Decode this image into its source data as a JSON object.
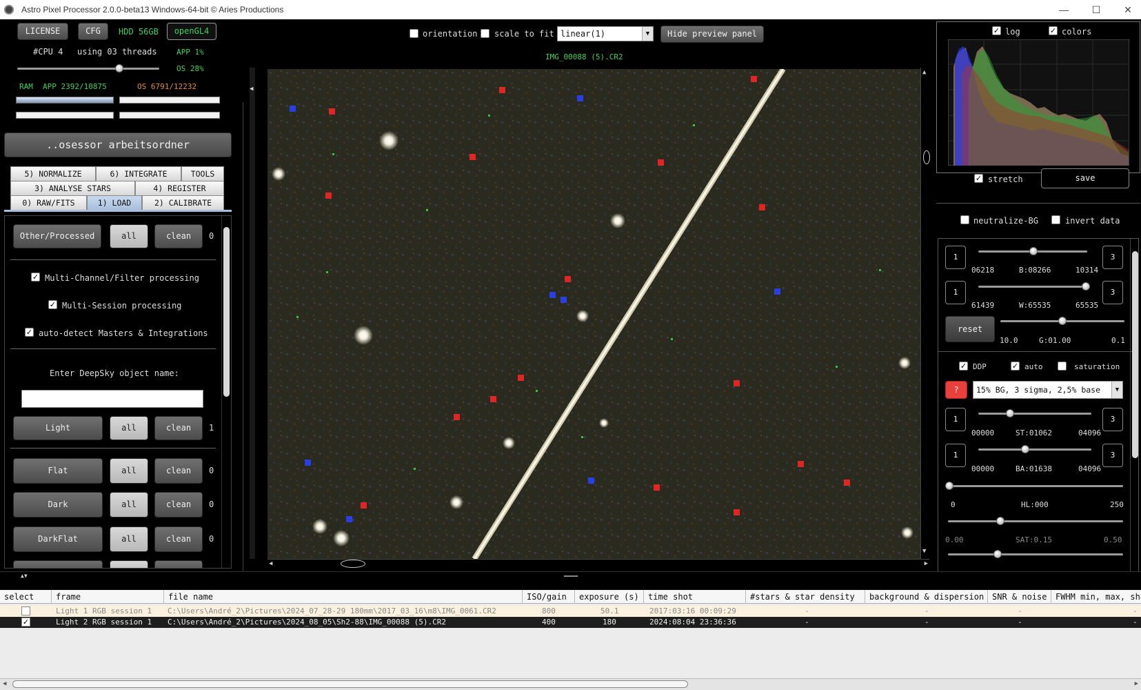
{
  "window": {
    "title": "Astro Pixel Processor 2.0.0-beta13 Windows-64-bit © Aries Productions"
  },
  "top_left": {
    "license": "LICENSE",
    "cfg": "CFG",
    "hdd": "HDD 56GB",
    "opengl": "openGL4",
    "cpu": "#CPU 4",
    "threads": "using 03 threads",
    "app_pct": "APP 1%",
    "os_pct": "OS 28%",
    "ram": "RAM",
    "ram_app": "APP 2392/10875",
    "ram_os": "OS 6791/12232",
    "threads_fraction": 0.72,
    "folder_button": "..osessor arbeitsordner"
  },
  "tabs": [
    {
      "label": "5) NORMALIZE"
    },
    {
      "label": "6) INTEGRATE"
    },
    {
      "label": "TOOLS"
    },
    {
      "label": "3) ANALYSE STARS"
    },
    {
      "label": "4) REGISTER"
    },
    {
      "label": "0) RAW/FITS"
    },
    {
      "label": "1) LOAD",
      "selected": true
    },
    {
      "label": "2) CALIBRATE"
    }
  ],
  "load_panel": {
    "other_label": "Other/Processed",
    "all": "all",
    "clean": "clean",
    "other_count": "0",
    "multi_channel": "Multi-Channel/Filter processing",
    "multi_session": "Multi-Session processing",
    "auto_detect": "auto-detect Masters & Integrations",
    "deepsky_label": "Enter DeepSky object name:",
    "deepsky_value": "",
    "groups": [
      {
        "label": "Light",
        "count": "1"
      },
      {
        "label": "Flat",
        "count": "0"
      },
      {
        "label": "Dark",
        "count": "0"
      },
      {
        "label": "DarkFlat",
        "count": "0"
      }
    ]
  },
  "preview_toolbar": {
    "orientation": "orientation",
    "scale_to_fit": "scale to fit",
    "stretch_mode": "linear(1)",
    "hide_button": "Hide preview panel",
    "filename": "IMG_00088 (5).CR2"
  },
  "right_panel": {
    "log": "log",
    "colors": "colors",
    "stretch": "stretch",
    "save": "save",
    "neutralize": "neutralize-BG",
    "invert": "invert data",
    "b_min": "06218",
    "b_val": "B:08266",
    "b_max": "10314",
    "w_min": "61439",
    "w_val": "W:65535",
    "w_max": "65535",
    "reset": "reset",
    "g_min": "10.0",
    "g_val": "G:01.00",
    "g_max": "0.1",
    "ddp": "DDP",
    "auto": "auto",
    "saturation": "saturation",
    "question": "?",
    "preset": "15% BG, 3 sigma, 2,5% base",
    "st_min": "00000",
    "st_val": "ST:01062",
    "st_max": "04096",
    "ba_min": "00000",
    "ba_val": "BA:01638",
    "ba_max": "04096",
    "hl_min": "0",
    "hl_val": "HL:000",
    "hl_max": "250",
    "sat_min": "0.00",
    "sat_val": "SAT:0.15",
    "sat_max": "0.50",
    "btn1": "1",
    "btn3": "3"
  },
  "table": {
    "columns": [
      "select",
      "frame",
      "file name",
      "ISO/gain",
      "exposure (s)",
      "time shot",
      "#stars & star density",
      "background & dispersion",
      "SNR & noise",
      "FWHM min, max, sha"
    ],
    "rows": [
      {
        "selected": false,
        "frame": "Light 1 RGB session 1",
        "file": "C:\\Users\\André_2\\Pictures\\2024_07_28-29 180mm\\2017_03_16\\m8\\IMG_0061.CR2",
        "iso": "800",
        "exposure": "50.1",
        "time": "2017:03:16 00:09:29",
        "stars": "-",
        "bg": "-",
        "snr": "-",
        "fwhm": "-"
      },
      {
        "selected": true,
        "frame": "Light 2 RGB session 1",
        "file": "C:\\Users\\André_2\\Pictures\\2024_08_05\\Sh2-88\\IMG_00088 (5).CR2",
        "iso": "400",
        "exposure": "180",
        "time": "2024:08:04 23:36:36",
        "stars": "-",
        "bg": "-",
        "snr": "-",
        "fwhm": "-"
      }
    ]
  }
}
